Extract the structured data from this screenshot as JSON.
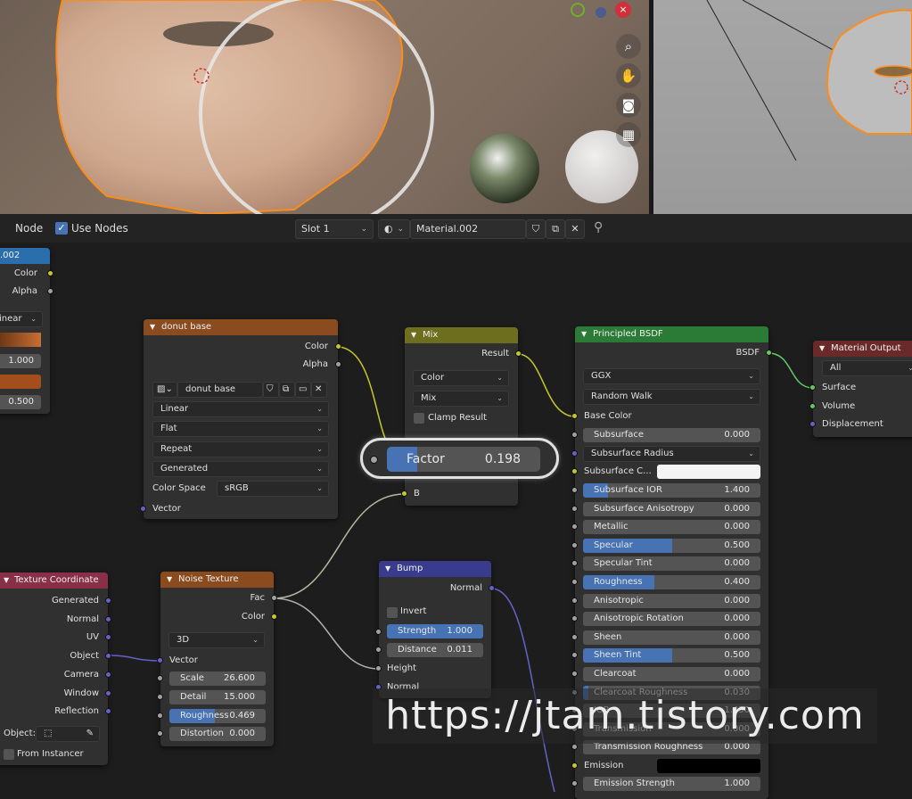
{
  "header": {
    "node_menu": "Node",
    "use_nodes_label": "Use Nodes",
    "slot": "Slot 1",
    "material_name": "Material.002"
  },
  "image_node": {
    "title": ".002",
    "out_color": "Color",
    "out_alpha": "Alpha",
    "interp": "inear",
    "value1": "1.000",
    "value2": "0.500"
  },
  "donut_base": {
    "title": "donut base",
    "out_color": "Color",
    "out_alpha": "Alpha",
    "image_name": "donut base",
    "interpolation": "Linear",
    "projection": "Flat",
    "extension": "Repeat",
    "source": "Generated",
    "color_space_label": "Color Space",
    "color_space": "sRGB",
    "in_vector": "Vector"
  },
  "mix": {
    "title": "Mix",
    "out_result": "Result",
    "data_type": "Color",
    "blend_type": "Mix",
    "clamp_label": "Clamp Result",
    "factor_label": "Factor",
    "factor_value": "0.198",
    "factor_fraction": 0.198,
    "in_b": "B"
  },
  "principled": {
    "title": "Principled BSDF",
    "out_bsdf": "BSDF",
    "distribution": "GGX",
    "subsurface_method": "Random Walk",
    "base_color_label": "Base Color",
    "base_color_hex": "#b8916b",
    "subsurface_radius_label": "Subsurface Radius",
    "subsurface_color_label": "Subsurface C...",
    "emission_label": "Emission",
    "params": [
      {
        "label": "Subsurface",
        "value": "0.000",
        "fraction": 0
      },
      {
        "label": "Subsurface IOR",
        "value": "1.400",
        "fraction": 0.14
      },
      {
        "label": "Subsurface Anisotropy",
        "value": "0.000",
        "fraction": 0
      },
      {
        "label": "Metallic",
        "value": "0.000",
        "fraction": 0
      },
      {
        "label": "Specular",
        "value": "0.500",
        "fraction": 0.5
      },
      {
        "label": "Specular Tint",
        "value": "0.000",
        "fraction": 0
      },
      {
        "label": "Roughness",
        "value": "0.400",
        "fraction": 0.4
      },
      {
        "label": "Anisotropic",
        "value": "0.000",
        "fraction": 0
      },
      {
        "label": "Anisotropic Rotation",
        "value": "0.000",
        "fraction": 0
      },
      {
        "label": "Sheen",
        "value": "0.000",
        "fraction": 0
      },
      {
        "label": "Sheen Tint",
        "value": "0.500",
        "fraction": 0.5
      },
      {
        "label": "Clearcoat",
        "value": "0.000",
        "fraction": 0
      },
      {
        "label": "Clearcoat Roughness",
        "value": "0.030",
        "fraction": 0.03
      },
      {
        "label": "IOR",
        "value": "1.450",
        "fraction": 0
      },
      {
        "label": "Transmission",
        "value": "0.000",
        "fraction": 0
      },
      {
        "label": "Transmission Roughness",
        "value": "0.000",
        "fraction": 0
      }
    ],
    "emission_strength_label": "Emission Strength",
    "emission_strength_value": "1.000"
  },
  "material_output": {
    "title": "Material Output",
    "target": "All",
    "in_surface": "Surface",
    "in_volume": "Volume",
    "in_displacement": "Displacement"
  },
  "tex_coord": {
    "title": "Texture Coordinate",
    "outputs": [
      "Generated",
      "Normal",
      "UV",
      "Object",
      "Camera",
      "Window",
      "Reflection"
    ],
    "object_label": "Object:",
    "from_instancer": "From Instancer"
  },
  "noise": {
    "title": "Noise Texture",
    "out_fac": "Fac",
    "out_color": "Color",
    "dimensions": "3D",
    "in_vector": "Vector",
    "scale_label": "Scale",
    "scale_value": "26.600",
    "detail_label": "Detail",
    "detail_value": "15.000",
    "roughness_label": "Roughness",
    "roughness_value": "0.469",
    "roughness_fraction": 0.469,
    "distortion_label": "Distortion",
    "distortion_value": "0.000"
  },
  "bump": {
    "title": "Bump",
    "out_normal": "Normal",
    "invert_label": "Invert",
    "strength_label": "Strength",
    "strength_value": "1.000",
    "strength_fraction": 1.0,
    "distance_label": "Distance",
    "distance_value": "0.011",
    "in_height": "Height",
    "in_normal": "Normal"
  },
  "watermark": "https://jtam.tistory.com",
  "colors": {
    "texture_header": "#8a4b1e",
    "shader_header": "#2b7a35",
    "color_header": "#6e6e1f",
    "vector_header": "#393b8f",
    "input_header": "#8a2f48",
    "output_header": "#6b2a2a",
    "selection": "#4772b3"
  }
}
